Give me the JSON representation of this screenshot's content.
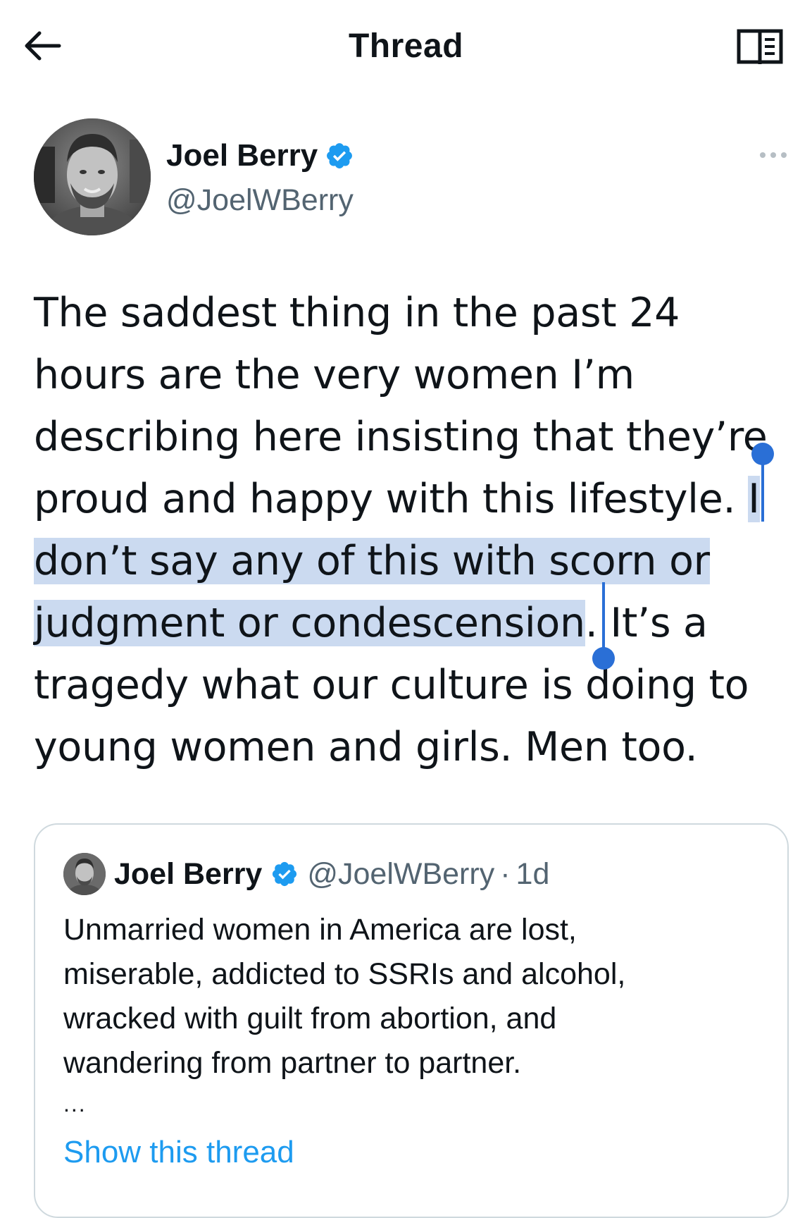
{
  "header": {
    "title": "Thread",
    "back_icon": "arrow-left-icon",
    "reader_icon": "reader-mode-icon"
  },
  "author": {
    "name": "Joel Berry",
    "handle": "@JoelWBerry",
    "verified": true,
    "more_icon": "more-horizontal-icon"
  },
  "tweet": {
    "lines": [
      "The saddest thing in the past 24",
      "hours are the very women I’m",
      "describing here insisting that they’re",
      "proud and happy with this lifestyle. ",
      "I",
      "don’t say any of this with scorn or",
      "judgment or condescension",
      ". It’s a",
      "tragedy what our culture is doing to",
      "young women and girls. Men too."
    ]
  },
  "quote": {
    "name": "Joel Berry",
    "handle": "@JoelWBerry",
    "separator": "·",
    "time": "1d",
    "lines": [
      "Unmarried women in America are lost,",
      "miserable, addicted to SSRIs and alcohol,",
      "wracked with guilt from abortion, and",
      "wandering from partner to partner."
    ],
    "ellipsis": "...",
    "show_thread": "Show this thread"
  },
  "colors": {
    "accent": "#1d9bf0",
    "selection": "#cbdaf0",
    "selection_handle": "#2a6fd6",
    "secondary_text": "#536471",
    "border": "#cfd9de"
  }
}
